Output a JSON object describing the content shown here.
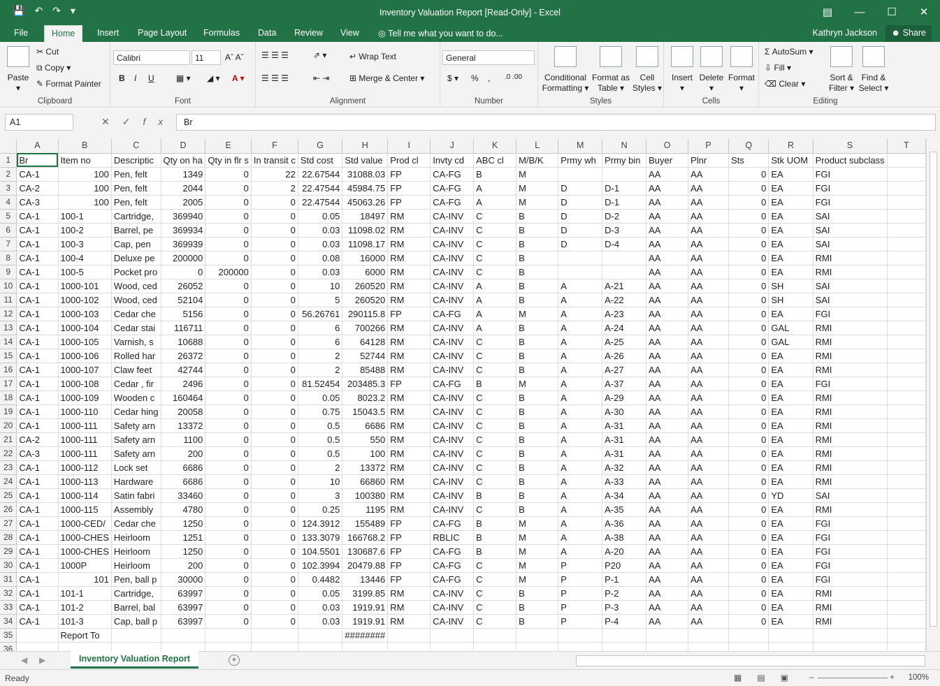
{
  "window": {
    "title": "Inventory Valuation Report  [Read-Only] - Excel"
  },
  "menu": {
    "tabs": [
      "File",
      "Home",
      "Insert",
      "Page Layout",
      "Formulas",
      "Data",
      "Review",
      "View"
    ],
    "tell_me": "Tell me what you want to do...",
    "user": "Kathryn Jackson",
    "share": "Share"
  },
  "ribbon": {
    "clipboard": {
      "label": "Clipboard",
      "paste": "Paste",
      "cut": "Cut",
      "copy": "Copy",
      "format_painter": "Format Painter"
    },
    "font": {
      "label": "Font",
      "name": "Calibri",
      "size": "11"
    },
    "alignment": {
      "label": "Alignment",
      "wrap_text": "Wrap Text",
      "merge_center": "Merge & Center"
    },
    "number": {
      "label": "Number",
      "format": "General"
    },
    "styles": {
      "label": "Styles",
      "conditional": "Conditional",
      "conditional2": "Formatting",
      "format_as": "Format as",
      "format_as2": "Table",
      "cell": "Cell",
      "cell2": "Styles"
    },
    "cells": {
      "label": "Cells",
      "insert": "Insert",
      "delete": "Delete",
      "format": "Format"
    },
    "editing": {
      "label": "Editing",
      "autosum": "AutoSum",
      "fill": "Fill",
      "clear": "Clear",
      "sort": "Sort &",
      "sort2": "Filter",
      "find": "Find &",
      "find2": "Select"
    }
  },
  "formula_bar": {
    "name_box": "A1",
    "formula": "Br"
  },
  "sheet": {
    "columns": [
      "A",
      "B",
      "C",
      "D",
      "E",
      "F",
      "G",
      "H",
      "I",
      "J",
      "K",
      "L",
      "M",
      "N",
      "O",
      "P",
      "Q",
      "R",
      "S",
      "T"
    ],
    "rows": [
      [
        "Br",
        "Item no",
        "Descriptic",
        "Qty on ha",
        "Qty in flr s",
        "In transit c",
        "Std cost",
        "Std value",
        "Prod cl",
        "Invty cd",
        "ABC cl",
        "M/B/K",
        "Prmy wh",
        "Prmy bin",
        "Buyer",
        "Plnr",
        "Sts",
        "Stk UOM",
        "Product subclass",
        ""
      ],
      [
        "CA-1",
        "100",
        "Pen, felt",
        "1349",
        "0",
        "22",
        "22.67544",
        "31088.03",
        "FP",
        "CA-FG",
        "B",
        "M",
        "",
        "",
        "AA",
        "AA",
        "0",
        "EA",
        "FGI",
        ""
      ],
      [
        "CA-2",
        "100",
        "Pen, felt",
        "2044",
        "0",
        "2",
        "22.47544",
        "45984.75",
        "FP",
        "CA-FG",
        "A",
        "M",
        "D",
        "D-1",
        "AA",
        "AA",
        "0",
        "EA",
        "FGI",
        ""
      ],
      [
        "CA-3",
        "100",
        "Pen, felt",
        "2005",
        "0",
        "0",
        "22.47544",
        "45063.26",
        "FP",
        "CA-FG",
        "A",
        "M",
        "D",
        "D-1",
        "AA",
        "AA",
        "0",
        "EA",
        "FGI",
        ""
      ],
      [
        "CA-1",
        "100-1",
        "Cartridge,",
        "369940",
        "0",
        "0",
        "0.05",
        "18497",
        "RM",
        "CA-INV",
        "C",
        "B",
        "D",
        "D-2",
        "AA",
        "AA",
        "0",
        "EA",
        "SAI",
        ""
      ],
      [
        "CA-1",
        "100-2",
        "Barrel, pe",
        "369934",
        "0",
        "0",
        "0.03",
        "11098.02",
        "RM",
        "CA-INV",
        "C",
        "B",
        "D",
        "D-3",
        "AA",
        "AA",
        "0",
        "EA",
        "SAI",
        ""
      ],
      [
        "CA-1",
        "100-3",
        "Cap, pen",
        "369939",
        "0",
        "0",
        "0.03",
        "11098.17",
        "RM",
        "CA-INV",
        "C",
        "B",
        "D",
        "D-4",
        "AA",
        "AA",
        "0",
        "EA",
        "SAI",
        ""
      ],
      [
        "CA-1",
        "100-4",
        "Deluxe pe",
        "200000",
        "0",
        "0",
        "0.08",
        "16000",
        "RM",
        "CA-INV",
        "C",
        "B",
        "",
        "",
        "AA",
        "AA",
        "0",
        "EA",
        "RMI",
        ""
      ],
      [
        "CA-1",
        "100-5",
        "Pocket pro",
        "0",
        "200000",
        "0",
        "0.03",
        "6000",
        "RM",
        "CA-INV",
        "C",
        "B",
        "",
        "",
        "AA",
        "AA",
        "0",
        "EA",
        "RMI",
        ""
      ],
      [
        "CA-1",
        "1000-101",
        "Wood, ced",
        "26052",
        "0",
        "0",
        "10",
        "260520",
        "RM",
        "CA-INV",
        "A",
        "B",
        "A",
        "A-21",
        "AA",
        "AA",
        "0",
        "SH",
        "SAI",
        ""
      ],
      [
        "CA-1",
        "1000-102",
        "Wood, ced",
        "52104",
        "0",
        "0",
        "5",
        "260520",
        "RM",
        "CA-INV",
        "A",
        "B",
        "A",
        "A-22",
        "AA",
        "AA",
        "0",
        "SH",
        "SAI",
        ""
      ],
      [
        "CA-1",
        "1000-103",
        "Cedar che",
        "5156",
        "0",
        "0",
        "56.26761",
        "290115.8",
        "FP",
        "CA-FG",
        "A",
        "M",
        "A",
        "A-23",
        "AA",
        "AA",
        "0",
        "EA",
        "FGI",
        ""
      ],
      [
        "CA-1",
        "1000-104",
        "Cedar stai",
        "116711",
        "0",
        "0",
        "6",
        "700266",
        "RM",
        "CA-INV",
        "A",
        "B",
        "A",
        "A-24",
        "AA",
        "AA",
        "0",
        "GAL",
        "RMI",
        ""
      ],
      [
        "CA-1",
        "1000-105",
        "Varnish, s",
        "10688",
        "0",
        "0",
        "6",
        "64128",
        "RM",
        "CA-INV",
        "C",
        "B",
        "A",
        "A-25",
        "AA",
        "AA",
        "0",
        "GAL",
        "RMI",
        ""
      ],
      [
        "CA-1",
        "1000-106",
        "Rolled har",
        "26372",
        "0",
        "0",
        "2",
        "52744",
        "RM",
        "CA-INV",
        "C",
        "B",
        "A",
        "A-26",
        "AA",
        "AA",
        "0",
        "EA",
        "RMI",
        ""
      ],
      [
        "CA-1",
        "1000-107",
        "Claw feet",
        "42744",
        "0",
        "0",
        "2",
        "85488",
        "RM",
        "CA-INV",
        "C",
        "B",
        "A",
        "A-27",
        "AA",
        "AA",
        "0",
        "EA",
        "RMI",
        ""
      ],
      [
        "CA-1",
        "1000-108",
        "Cedar , fir",
        "2496",
        "0",
        "0",
        "81.52454",
        "203485.3",
        "FP",
        "CA-FG",
        "B",
        "M",
        "A",
        "A-37",
        "AA",
        "AA",
        "0",
        "EA",
        "FGI",
        ""
      ],
      [
        "CA-1",
        "1000-109",
        "Wooden c",
        "160464",
        "0",
        "0",
        "0.05",
        "8023.2",
        "RM",
        "CA-INV",
        "C",
        "B",
        "A",
        "A-29",
        "AA",
        "AA",
        "0",
        "EA",
        "RMI",
        ""
      ],
      [
        "CA-1",
        "1000-110",
        "Cedar hing",
        "20058",
        "0",
        "0",
        "0.75",
        "15043.5",
        "RM",
        "CA-INV",
        "C",
        "B",
        "A",
        "A-30",
        "AA",
        "AA",
        "0",
        "EA",
        "RMI",
        ""
      ],
      [
        "CA-1",
        "1000-111",
        "Safety arn",
        "13372",
        "0",
        "0",
        "0.5",
        "6686",
        "RM",
        "CA-INV",
        "C",
        "B",
        "A",
        "A-31",
        "AA",
        "AA",
        "0",
        "EA",
        "RMI",
        ""
      ],
      [
        "CA-2",
        "1000-111",
        "Safety arn",
        "1100",
        "0",
        "0",
        "0.5",
        "550",
        "RM",
        "CA-INV",
        "C",
        "B",
        "A",
        "A-31",
        "AA",
        "AA",
        "0",
        "EA",
        "RMI",
        ""
      ],
      [
        "CA-3",
        "1000-111",
        "Safety arn",
        "200",
        "0",
        "0",
        "0.5",
        "100",
        "RM",
        "CA-INV",
        "C",
        "B",
        "A",
        "A-31",
        "AA",
        "AA",
        "0",
        "EA",
        "RMI",
        ""
      ],
      [
        "CA-1",
        "1000-112",
        "Lock set",
        "6686",
        "0",
        "0",
        "2",
        "13372",
        "RM",
        "CA-INV",
        "C",
        "B",
        "A",
        "A-32",
        "AA",
        "AA",
        "0",
        "EA",
        "RMI",
        ""
      ],
      [
        "CA-1",
        "1000-113",
        "Hardware",
        "6686",
        "0",
        "0",
        "10",
        "66860",
        "RM",
        "CA-INV",
        "C",
        "B",
        "A",
        "A-33",
        "AA",
        "AA",
        "0",
        "EA",
        "RMI",
        ""
      ],
      [
        "CA-1",
        "1000-114",
        "Satin fabri",
        "33460",
        "0",
        "0",
        "3",
        "100380",
        "RM",
        "CA-INV",
        "B",
        "B",
        "A",
        "A-34",
        "AA",
        "AA",
        "0",
        "YD",
        "SAI",
        ""
      ],
      [
        "CA-1",
        "1000-115",
        "Assembly",
        "4780",
        "0",
        "0",
        "0.25",
        "1195",
        "RM",
        "CA-INV",
        "C",
        "B",
        "A",
        "A-35",
        "AA",
        "AA",
        "0",
        "EA",
        "RMI",
        ""
      ],
      [
        "CA-1",
        "1000-CED/",
        "Cedar che",
        "1250",
        "0",
        "0",
        "124.3912",
        "155489",
        "FP",
        "CA-FG",
        "B",
        "M",
        "A",
        "A-36",
        "AA",
        "AA",
        "0",
        "EA",
        "FGI",
        ""
      ],
      [
        "CA-1",
        "1000-CHES",
        "Heirloom",
        "1251",
        "0",
        "0",
        "133.3079",
        "166768.2",
        "FP",
        "RBLIC",
        "B",
        "M",
        "A",
        "A-38",
        "AA",
        "AA",
        "0",
        "EA",
        "FGI",
        ""
      ],
      [
        "CA-1",
        "1000-CHES",
        "Heirloom",
        "1250",
        "0",
        "0",
        "104.5501",
        "130687.6",
        "FP",
        "CA-FG",
        "B",
        "M",
        "A",
        "A-20",
        "AA",
        "AA",
        "0",
        "EA",
        "FGI",
        ""
      ],
      [
        "CA-1",
        "1000P",
        "Heirloom",
        "200",
        "0",
        "0",
        "102.3994",
        "20479.88",
        "FP",
        "CA-FG",
        "C",
        "M",
        "P",
        "P20",
        "AA",
        "AA",
        "0",
        "EA",
        "FGI",
        ""
      ],
      [
        "CA-1",
        "101",
        "Pen, ball p",
        "30000",
        "0",
        "0",
        "0.4482",
        "13446",
        "FP",
        "CA-FG",
        "C",
        "M",
        "P",
        "P-1",
        "AA",
        "AA",
        "0",
        "EA",
        "FGI",
        ""
      ],
      [
        "CA-1",
        "101-1",
        "Cartridge,",
        "63997",
        "0",
        "0",
        "0.05",
        "3199.85",
        "RM",
        "CA-INV",
        "C",
        "B",
        "P",
        "P-2",
        "AA",
        "AA",
        "0",
        "EA",
        "RMI",
        ""
      ],
      [
        "CA-1",
        "101-2",
        "Barrel, bal",
        "63997",
        "0",
        "0",
        "0.03",
        "1919.91",
        "RM",
        "CA-INV",
        "C",
        "B",
        "P",
        "P-3",
        "AA",
        "AA",
        "0",
        "EA",
        "RMI",
        ""
      ],
      [
        "CA-1",
        "101-3",
        "Cap, ball p",
        "63997",
        "0",
        "0",
        "0.03",
        "1919.91",
        "RM",
        "CA-INV",
        "C",
        "B",
        "P",
        "P-4",
        "AA",
        "AA",
        "0",
        "EA",
        "RMI",
        ""
      ],
      [
        "",
        "Report To",
        "",
        "",
        "",
        "",
        "",
        "########",
        "",
        "",
        "",
        "",
        "",
        "",
        "",
        "",
        "",
        "",
        "",
        ""
      ],
      [
        "",
        "",
        "",
        "",
        "",
        "",
        "",
        "",
        "",
        "",
        "",
        "",
        "",
        "",
        "",
        "",
        "",
        "",
        "",
        ""
      ]
    ]
  },
  "sheet_tab": "Inventory Valuation Report",
  "status": {
    "ready": "Ready",
    "zoom": "100%"
  }
}
